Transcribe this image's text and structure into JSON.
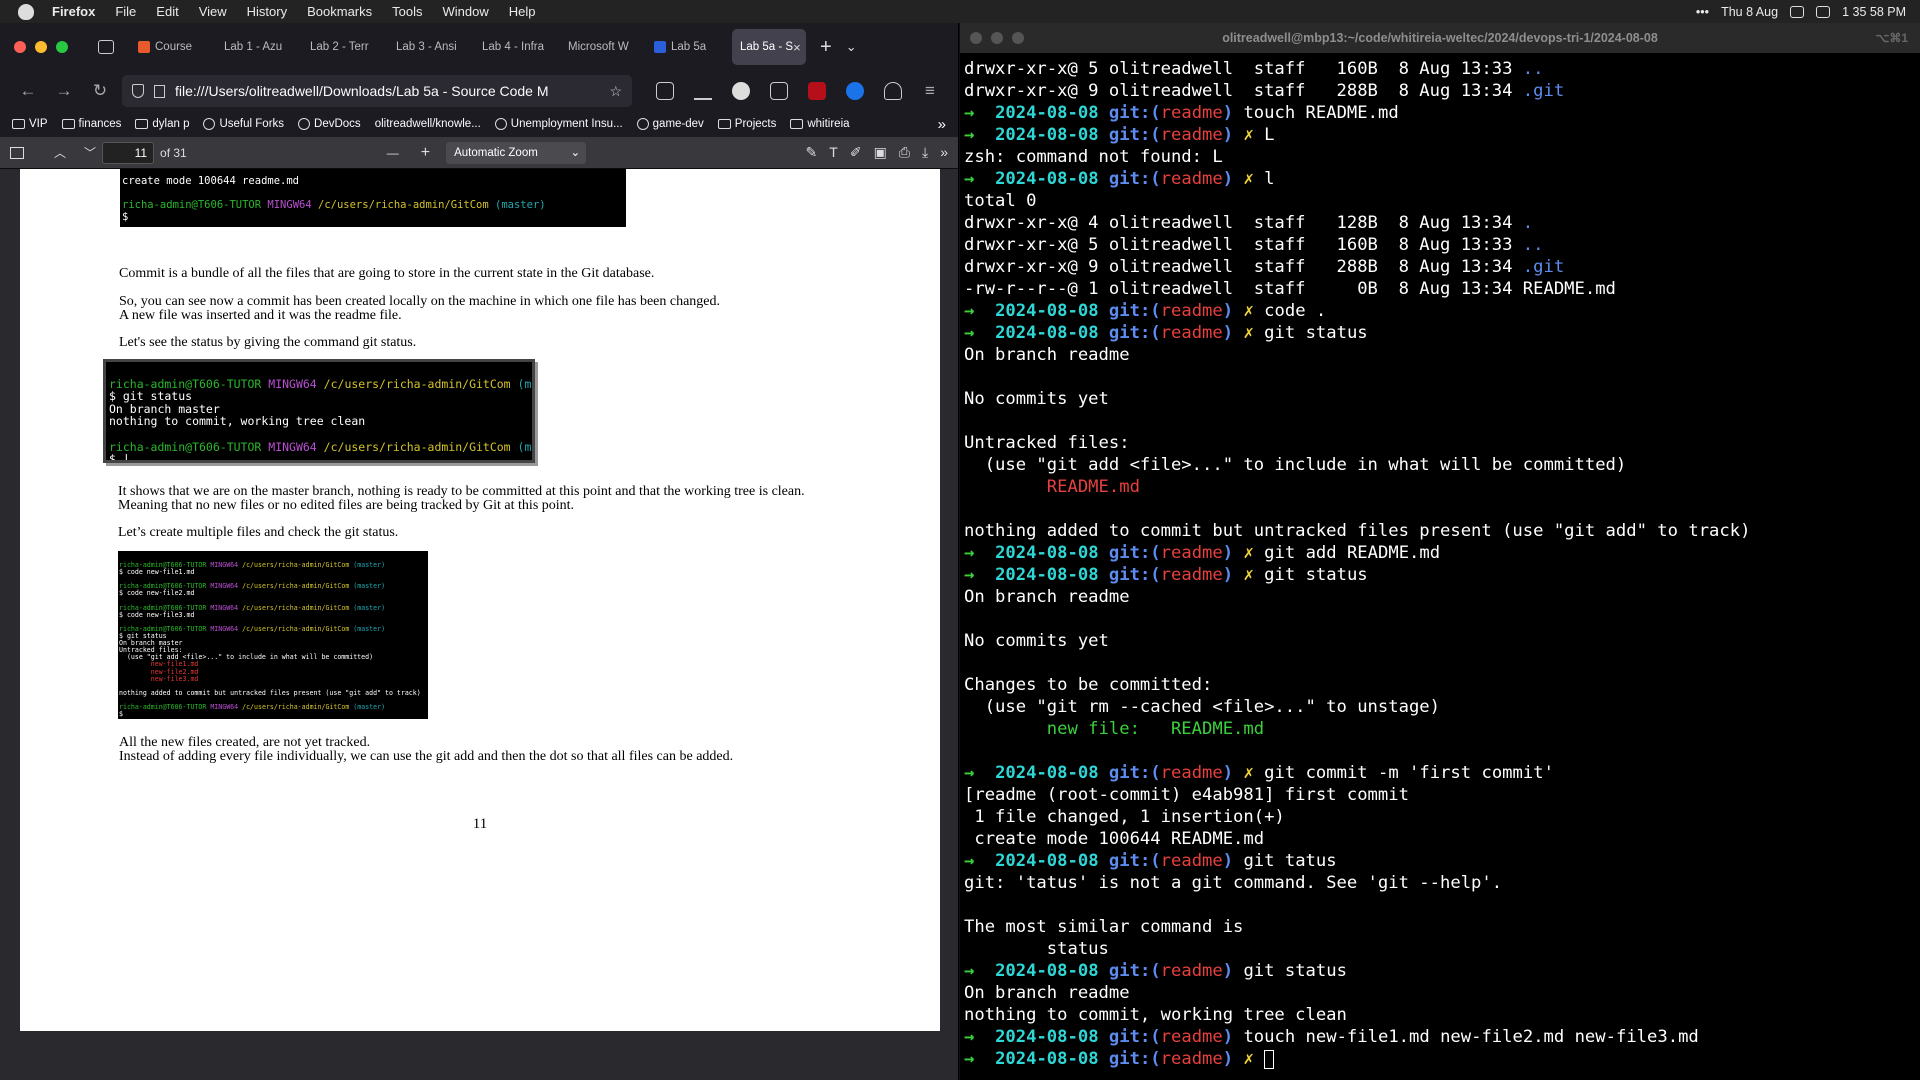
{
  "menubar": {
    "app": "Firefox",
    "items": [
      "File",
      "Edit",
      "View",
      "History",
      "Bookmarks",
      "Tools",
      "Window",
      "Help"
    ],
    "date": "Thu 8 Aug",
    "time": "1 35 58 PM",
    "more": "•••"
  },
  "firefox": {
    "tabs": [
      {
        "label": "Course",
        "fav": "#e8592b"
      },
      {
        "label": "Lab 1 - Azu",
        "fav": "#1c1b22"
      },
      {
        "label": "Lab 2 - Terr",
        "fav": "#1c1b22"
      },
      {
        "label": "Lab 3 - Ansi",
        "fav": "#1c1b22"
      },
      {
        "label": "Lab 4 - Infra",
        "fav": "#1c1b22"
      },
      {
        "label": "Microsoft W",
        "fav": "#1c1b22"
      },
      {
        "label": "Lab 5a",
        "fav": "#2b5fd9"
      },
      {
        "label": "Lab 5a - S",
        "active": true
      }
    ],
    "new_tab": "+",
    "tab_menu": "⌄",
    "url": "file:///Users/olitreadwell/Downloads/Lab 5a - Source Code M",
    "bookmarks": [
      {
        "label": "VIP",
        "icon": "folder"
      },
      {
        "label": "finances",
        "icon": "folder"
      },
      {
        "label": "dylan p",
        "icon": "folder"
      },
      {
        "label": "Useful Forks",
        "icon": "globe"
      },
      {
        "label": "DevDocs",
        "icon": "globe"
      },
      {
        "label": "olitreadwell/knowle...",
        "icon": "none"
      },
      {
        "label": "Unemployment Insu...",
        "icon": "globe"
      },
      {
        "label": "game-dev",
        "icon": "globe"
      },
      {
        "label": "Projects",
        "icon": "folder"
      },
      {
        "label": "whitireia",
        "icon": "folder"
      }
    ],
    "bookmarks_more": "»",
    "pdf": {
      "page_input": "11",
      "page_count": "of 31",
      "zoom": "Automatic Zoom",
      "zoom_out": "—",
      "zoom_in": "+"
    }
  },
  "pdf_page": {
    "top_img": {
      "line1": "create mode 100644 readme.md",
      "prompt_user": "richa-admin@T606-TUTOR",
      "prompt_env": "MINGW64",
      "prompt_path": "/c/users/richa-admin/GitCom",
      "prompt_branch": "(master)",
      "dollar": "$"
    },
    "p1": "Commit is a bundle of all the files that are going to store in the current state in the Git database.",
    "p2a": "So, you can see now a commit has been created locally on the machine in which one file has been changed.",
    "p2b": "A new file was inserted and it was the readme file.",
    "p3": "Let's see the status by giving the command git status.",
    "status_img": {
      "cmd": "$ git status",
      "out1": "On branch master",
      "out2": "nothing to commit, working tree clean",
      "dollar": "$ |"
    },
    "p4a": "It shows that we are on the master branch, nothing is ready to be committed at this point and that the working tree is clean.",
    "p4b": "Meaning that no new files or no edited files are being tracked by Git at this point.",
    "p5": "Let’s create multiple files and check the git status.",
    "multi_img": {
      "cmd1": "$ code new-file1.md",
      "cmd2": "$ code new-file2.md",
      "cmd3": "$ code new-file3.md",
      "cmd4": "$ git status",
      "o1": "On branch master",
      "o2": "Untracked files:",
      "o3": "  (use \"git add <file>...\" to include in what will be committed)",
      "f1": "        new-file1.md",
      "f2": "        new-file2.md",
      "f3": "        new-file3.md",
      "o4": "nothing added to commit but untracked files present (use \"git add\" to track)",
      "dollar": "$"
    },
    "p6a": "All the new files created, are not yet tracked.",
    "p6b": "Instead of adding every file individually, we can use the git add and then the dot so that all files can be added.",
    "page_number": "11"
  },
  "terminal": {
    "title": "olitreadwell@mbp13:~/code/whitireia-weltec/2024/devops-tri-1/2024-08-08",
    "shortcut": "⌥⌘1",
    "prompt_date": "2024-08-08",
    "prompt_git": "git:(",
    "prompt_branch": "readme",
    "prompt_close": ")",
    "arrow": "→",
    "x": "✗",
    "lines": {
      "l1": "drwxr-xr-x@ 5 olitreadwell  staff   160B  8 Aug 13:33 ",
      "l1b": "..",
      "l2": "drwxr-xr-x@ 9 olitreadwell  staff   288B  8 Aug 13:34 ",
      "l2b": ".git",
      "c1": " touch README.md",
      "c2": " L",
      "e1": "zsh: command not found: L",
      "c3": " l",
      "t0": "total 0",
      "l3": "drwxr-xr-x@ 4 olitreadwell  staff   128B  8 Aug 13:34 ",
      "l3b": ".",
      "l4": "drwxr-xr-x@ 5 olitreadwell  staff   160B  8 Aug 13:33 ",
      "l4b": "..",
      "l5": "drwxr-xr-x@ 9 olitreadwell  staff   288B  8 Aug 13:34 ",
      "l5b": ".git",
      "l6": "-rw-r--r--@ 1 olitreadwell  staff     0B  8 Aug 13:34 README.md",
      "c4": " code .",
      "c5": " git status",
      "s1": "On branch readme",
      "s2": "No commits yet",
      "s3": "Untracked files:",
      "s4": "  (use \"git add <file>...\" to include in what will be committed)",
      "s5": "        README.md",
      "s6": "nothing added to commit but untracked files present (use \"git add\" to track)",
      "c6": " git add README.md",
      "c7": " git status",
      "s7": "On branch readme",
      "s8": "No commits yet",
      "s9": "Changes to be committed:",
      "s10": "  (use \"git rm --cached <file>...\" to unstage)",
      "s11": "        new file:   README.md",
      "c8": " git commit -m 'first commit'",
      "m1": "[readme (root-commit) e4ab981] first commit",
      "m2": " 1 file changed, 1 insertion(+)",
      "m3": " create mode 100644 README.md",
      "c9": " git tatus",
      "g1": "git: 'tatus' is not a git command. See 'git --help'.",
      "g2": "The most similar command is",
      "g3": "        status",
      "c10": " git status",
      "s12": "On branch readme",
      "s13": "nothing to commit, working tree clean",
      "c11": " touch new-file1.md new-file2.md new-file3.md",
      "c12": " "
    }
  }
}
